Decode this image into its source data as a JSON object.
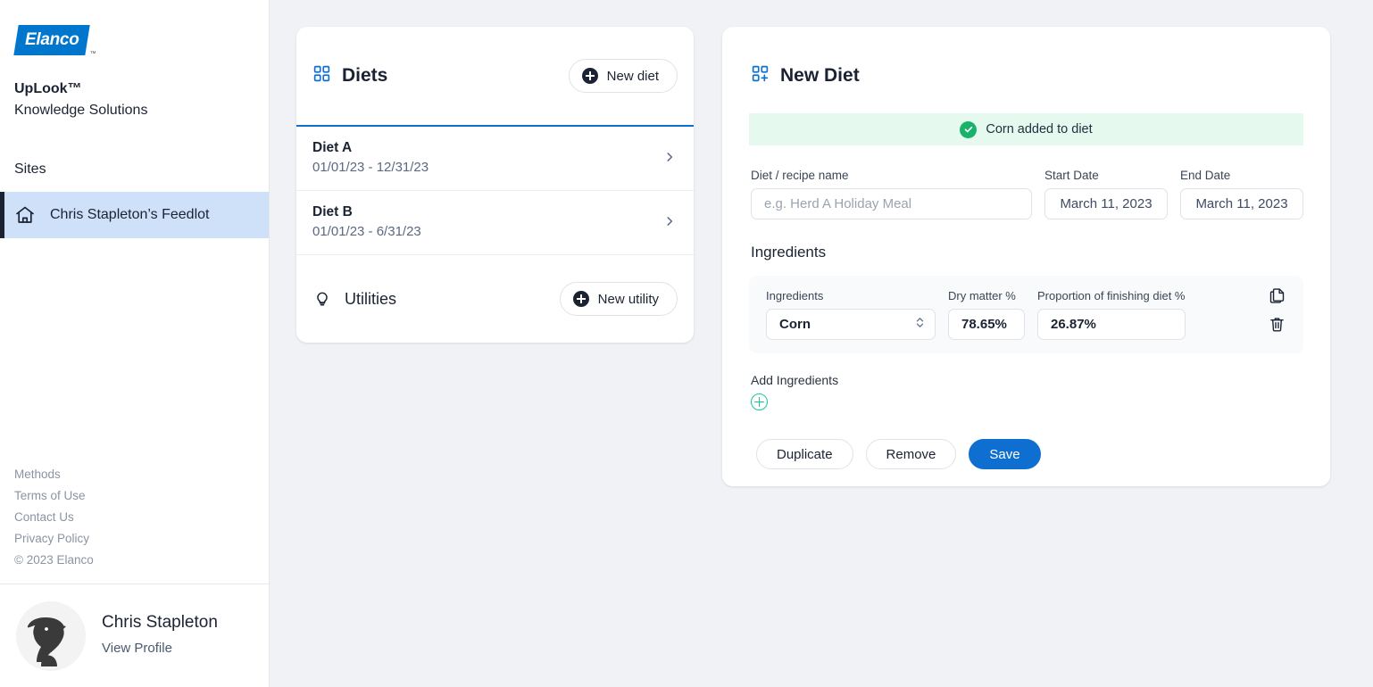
{
  "sidebar": {
    "logo": {
      "text": "Elanco",
      "tm": "™",
      "icon": "elanco-logo"
    },
    "brand": {
      "title": "UpLook™",
      "subtitle": "Knowledge Solutions"
    },
    "sites_label": "Sites",
    "nav_items": [
      {
        "label": "Chris Stapleton’s Feedlot",
        "icon": "home-icon",
        "active": true
      }
    ],
    "footer_links": [
      "Methods",
      "Terms of Use",
      "Contact Us",
      "Privacy Policy"
    ],
    "copyright": "© 2023 Elanco",
    "profile": {
      "name": "Chris Stapleton",
      "link": "View Profile",
      "avatar": "user-avatar"
    }
  },
  "diets_panel": {
    "icon": "grid-squares-icon",
    "title": "Diets",
    "new_button": {
      "label": "New diet",
      "icon": "plus-circle-icon"
    },
    "rows": [
      {
        "name": "Diet A",
        "dates": "01/01/23 - 12/31/23",
        "chevron": "chevron-right-icon"
      },
      {
        "name": "Diet B",
        "dates": "01/01/23 - 6/31/23",
        "chevron": "chevron-right-icon"
      }
    ],
    "utilities": {
      "icon": "lightbulb-icon",
      "label": "Utilities",
      "new_button": {
        "label": "New utility",
        "icon": "plus-circle-icon"
      }
    }
  },
  "new_diet_panel": {
    "icon": "grid-plus-icon",
    "title": "New Diet",
    "toast": {
      "text": "Corn added to diet",
      "icon": "check-circle-icon",
      "color": "#18b368",
      "bg": "#e6f9ef"
    },
    "fields": {
      "name": {
        "label": "Diet / recipe name",
        "placeholder": "e.g. Herd A Holiday Meal",
        "value": ""
      },
      "start_date": {
        "label": "Start Date",
        "value": "March 11, 2023"
      },
      "end_date": {
        "label": "End Date",
        "value": "March 11, 2023"
      }
    },
    "ingredients_label": "Ingredients",
    "ingredient_rows": [
      {
        "ingredient_label": "Ingredients",
        "ingredient_value": "Corn",
        "dry_matter_label": "Dry matter %",
        "dry_matter_value": "78.65%",
        "proportion_label": "Proportion of finishing diet %",
        "proportion_value": "26.87%",
        "copy_icon": "copy-icon",
        "delete_icon": "trash-icon"
      }
    ],
    "add_ingredients": {
      "label": "Add Ingredients",
      "icon": "plus-circle-outline-icon",
      "color": "#16c79a"
    },
    "actions": [
      {
        "label": "Duplicate",
        "style": "outline"
      },
      {
        "label": "Remove",
        "style": "outline"
      },
      {
        "label": "Save",
        "style": "primary"
      }
    ]
  },
  "colors": {
    "accent_blue": "#0f6fd1",
    "logo_blue": "#0077cc",
    "navy": "#1b2333",
    "active_nav_bg": "#cfe0f9",
    "page_bg": "#f0f2f5",
    "success_green": "#18b368",
    "teal": "#16c79a"
  }
}
